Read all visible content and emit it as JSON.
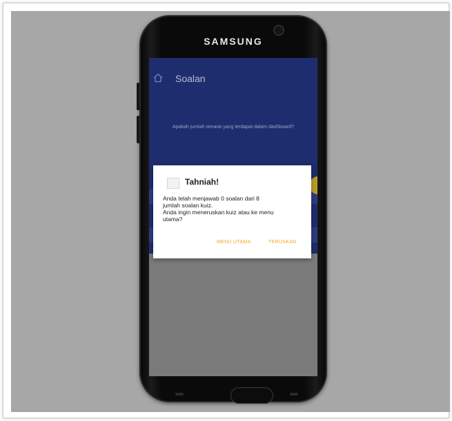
{
  "device": {
    "brand": "SAMSUNG"
  },
  "app": {
    "title": "Soalan",
    "question": "Apakah jumlah senarai yang terdapat dalam dashboard?"
  },
  "dialog": {
    "title": "Tahniah!",
    "message_lines": [
      "Anda telah menjawab 0 soalan dari 8",
      "jumlah soalan kuiz.",
      "Anda ingin meneruskan kuiz atau ke menu",
      "utama?"
    ],
    "buttons": {
      "menu": "MENU UTAMA",
      "continue": "TERUSKAN"
    }
  },
  "colors": {
    "appbar": "#1e2d6e",
    "accent": "#f5a623"
  },
  "icons": {
    "home": "home-icon",
    "dialog": "app-icon"
  }
}
